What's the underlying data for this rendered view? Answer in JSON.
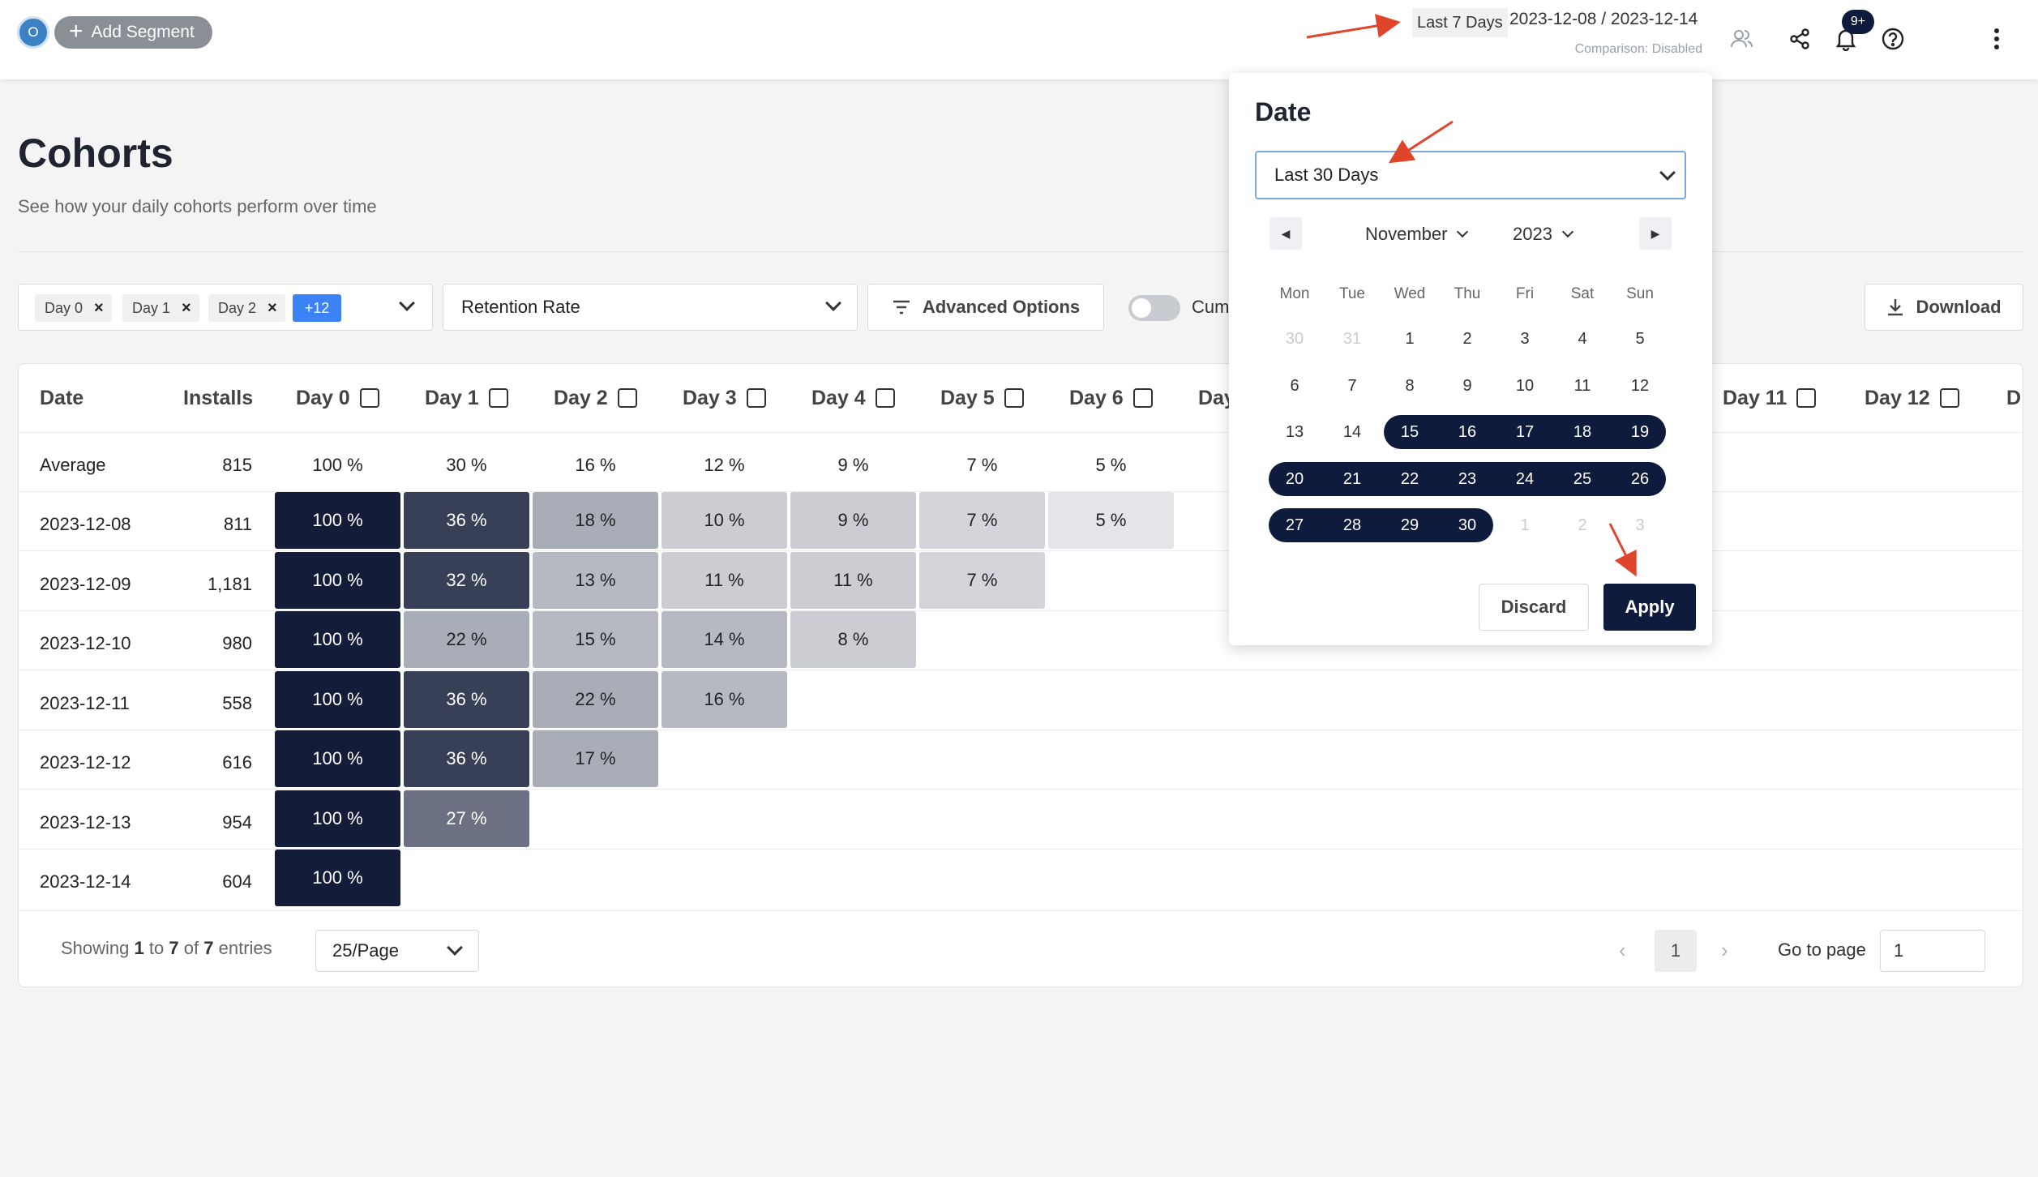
{
  "topbar": {
    "avatar_initial": "O",
    "add_segment_label": "Add Segment",
    "date_preset": "Last 7 Days",
    "date_range": "2023-12-08 / 2023-12-14",
    "comparison": "Comparison: Disabled",
    "notifications_badge": "9+"
  },
  "page": {
    "title": "Cohorts",
    "subtitle": "See how your daily cohorts perform over time"
  },
  "controls": {
    "chips": [
      "Day 0",
      "Day 1",
      "Day 2"
    ],
    "chip_remove_glyph": "×",
    "chips_more": "+12",
    "metric": "Retention Rate",
    "advanced_options": "Advanced Options",
    "cumulative_label": "Cum",
    "download": "Download"
  },
  "table": {
    "headers": {
      "date": "Date",
      "installs": "Installs",
      "day0": "Day 0",
      "day1": "Day 1",
      "day2": "Day 2",
      "day3": "Day 3",
      "day4": "Day 4",
      "day5": "Day 5",
      "day6": "Day 6",
      "day7": "Day",
      "day11": "Day 11",
      "day12": "Day 12",
      "day13": "D"
    },
    "average": {
      "label": "Average",
      "installs": "815",
      "values": [
        "100 %",
        "30 %",
        "16 %",
        "12 %",
        "9 %",
        "7 %",
        "5 %"
      ]
    },
    "rows": [
      {
        "date": "2023-12-08",
        "installs": "811",
        "values": [
          "100 %",
          "36 %",
          "18 %",
          "10 %",
          "9 %",
          "7 %",
          "5 %"
        ]
      },
      {
        "date": "2023-12-09",
        "installs": "1,181",
        "values": [
          "100 %",
          "32 %",
          "13 %",
          "11 %",
          "11 %",
          "7 %"
        ]
      },
      {
        "date": "2023-12-10",
        "installs": "980",
        "values": [
          "100 %",
          "22 %",
          "15 %",
          "14 %",
          "8 %"
        ]
      },
      {
        "date": "2023-12-11",
        "installs": "558",
        "values": [
          "100 %",
          "36 %",
          "22 %",
          "16 %"
        ]
      },
      {
        "date": "2023-12-12",
        "installs": "616",
        "values": [
          "100 %",
          "36 %",
          "17 %"
        ]
      },
      {
        "date": "2023-12-13",
        "installs": "954",
        "values": [
          "100 %",
          "27 %"
        ]
      },
      {
        "date": "2023-12-14",
        "installs": "604",
        "values": [
          "100 %"
        ]
      }
    ]
  },
  "pagination": {
    "showing": "Showing",
    "from": "1",
    "to_word": "to",
    "to": "7",
    "of_word": "of",
    "total": "7",
    "entries": "entries",
    "per_page": "25/Page",
    "current_page": "1",
    "goto_label": "Go to page",
    "goto_value": "1",
    "prev_glyph": "‹",
    "next_glyph": "›"
  },
  "date_popup": {
    "title": "Date",
    "preset": "Last 30 Days",
    "month": "November",
    "year": "2023",
    "weekdays": [
      "Mon",
      "Tue",
      "Wed",
      "Thu",
      "Fri",
      "Sat",
      "Sun"
    ],
    "weeks": [
      [
        "30",
        "31",
        "1",
        "2",
        "3",
        "4",
        "5"
      ],
      [
        "6",
        "7",
        "8",
        "9",
        "10",
        "11",
        "12"
      ],
      [
        "13",
        "14",
        "15",
        "16",
        "17",
        "18",
        "19"
      ],
      [
        "20",
        "21",
        "22",
        "23",
        "24",
        "25",
        "26"
      ],
      [
        "27",
        "28",
        "29",
        "30",
        "1",
        "2",
        "3"
      ]
    ],
    "discard": "Discard",
    "apply": "Apply"
  },
  "colors": {
    "navy": "#0f1b3d",
    "accent_blue": "#3b82f6",
    "annotation_red": "#e0452c"
  }
}
